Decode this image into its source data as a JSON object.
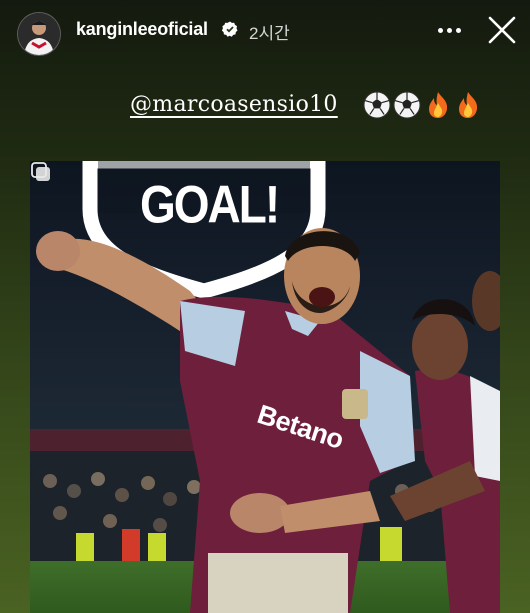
{
  "story": {
    "username": "kanginleeoficial",
    "time": "2시간",
    "mention": "@marcoasensio10",
    "emojis": [
      "soccer-ball",
      "soccer-ball",
      "fire",
      "fire"
    ],
    "sign_text": "GOAL!",
    "shirt_text": "Betano"
  },
  "icons": {
    "verified": "verified-badge-icon",
    "more": "more-options-icon",
    "close": "close-icon",
    "sticker": "copy-sticker-icon"
  },
  "colors": {
    "background_top": "#141a0f",
    "background_bottom": "#4a6222",
    "jersey_claret": "#6e1f3b",
    "jersey_sky": "#b7cde2"
  }
}
